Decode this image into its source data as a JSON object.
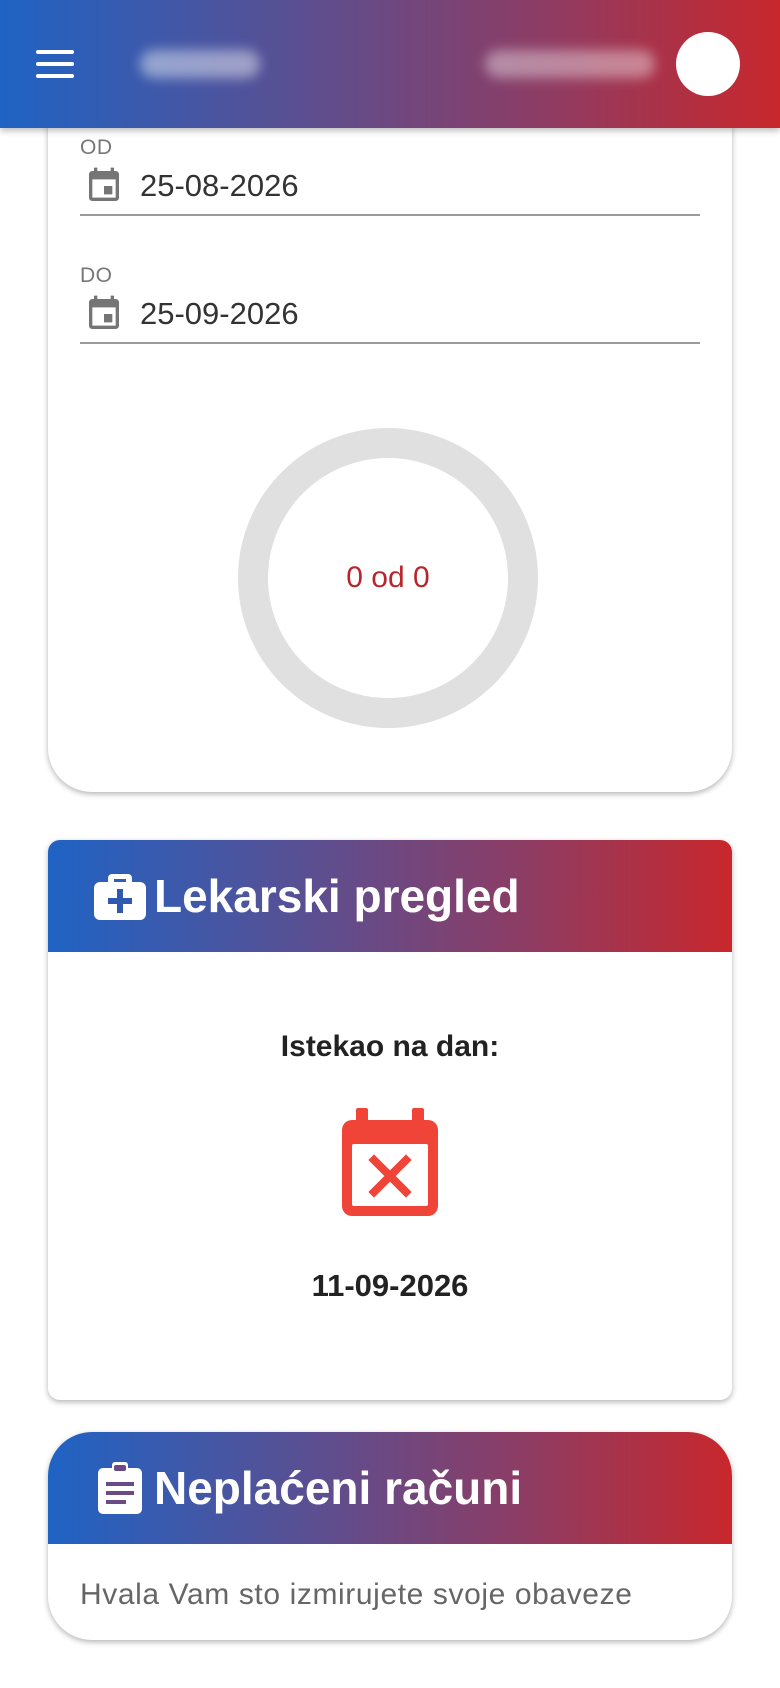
{
  "header": {
    "menu_icon": "menu-icon",
    "avatar_icon": "avatar"
  },
  "period": {
    "from": {
      "label": "OD",
      "value": "25-08-2026",
      "icon": "calendar-today-icon"
    },
    "to": {
      "label": "DO",
      "value": "25-09-2026",
      "icon": "calendar-today-icon"
    },
    "progress_text": "0 od 0",
    "progress_fraction": 0,
    "ring_color": "#e0e0e0",
    "text_color": "#b8262c"
  },
  "medical_exam": {
    "title": "Lekarski pregled",
    "icon": "medical-bag-icon",
    "status_label": "Istekao na dan:",
    "status_icon": "calendar-remove-icon",
    "date": "11-09-2026",
    "status_color": "#f04438"
  },
  "unpaid_bills": {
    "title": "Neplaćeni računi",
    "icon": "clipboard-text-icon",
    "message": "Hvala Vam sto izmirujete svoje obaveze"
  },
  "colors": {
    "gradient_start": "#1f63c4",
    "gradient_end": "#c8272c"
  }
}
